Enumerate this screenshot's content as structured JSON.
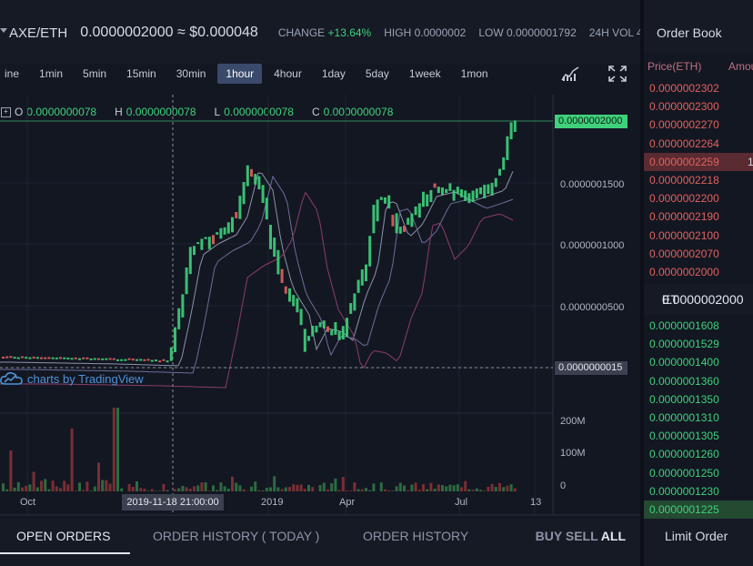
{
  "header": {
    "pair": "AXE/ETH",
    "price": "0.0000002000",
    "approx": "≈ $0.000048",
    "change_label": "CHANGE",
    "change_value": "+13.64%",
    "high_label": "HIGH",
    "high_value": "0.0000002",
    "low_label": "LOW",
    "low_value": "0.0000001792",
    "vol_label": "24H VOL",
    "vol_value": "4"
  },
  "timeframes": [
    "ine",
    "1min",
    "5min",
    "15min",
    "30min",
    "1hour",
    "4hour",
    "1day",
    "5day",
    "1week",
    "1mon"
  ],
  "active_timeframe": "1hour",
  "ohlc": {
    "check": "+",
    "o_label": "O",
    "o": "0.0000000078",
    "h_label": "H",
    "h": "0.0000000078",
    "l_label": "L",
    "l": "0.0000000078",
    "c_label": "C",
    "c": "0.0000000078"
  },
  "watermark": "charts by TradingView",
  "price_axis": [
    "0.0000001500",
    "0.0000001000",
    "0.0000000500"
  ],
  "price_tag_current": "0.0000002000",
  "price_tag_cursor": "0.0000000015",
  "volume_axis": [
    "200M",
    "100M",
    "0"
  ],
  "time_axis": [
    "Oct",
    "2019",
    "Apr",
    "Jul",
    "13"
  ],
  "time_cursor": "2019-11-18 21:00:00",
  "bottom_tabs": [
    "OPEN ORDERS",
    "ORDER HISTORY ( TODAY )",
    "ORDER HISTORY"
  ],
  "bottom_filters": {
    "buy": "BUY",
    "sell": "SELL",
    "all": "ALL"
  },
  "orderbook": {
    "title": "Order Book",
    "col_price": "Price(ETH)",
    "col_amount": "Amou",
    "asks": [
      {
        "price": "0.0000002302"
      },
      {
        "price": "0.0000002300"
      },
      {
        "price": "0.0000002270"
      },
      {
        "price": "0.0000002264"
      },
      {
        "price": "0.0000002259",
        "amount": "1"
      },
      {
        "price": "0.0000002218"
      },
      {
        "price": "0.0000002200"
      },
      {
        "price": "0.0000002190"
      },
      {
        "price": "0.0000002100"
      },
      {
        "price": "0.0000002070"
      },
      {
        "price": "0.0000002000"
      }
    ],
    "last": "0.0000002000",
    "last_unit": "ET",
    "bids": [
      {
        "price": "0.0000001608"
      },
      {
        "price": "0.0000001529"
      },
      {
        "price": "0.0000001400"
      },
      {
        "price": "0.0000001360"
      },
      {
        "price": "0.0000001350"
      },
      {
        "price": "0.0000001310"
      },
      {
        "price": "0.0000001305"
      },
      {
        "price": "0.0000001260"
      },
      {
        "price": "0.0000001250"
      },
      {
        "price": "0.0000001230"
      },
      {
        "price": "0.0000001225"
      }
    ],
    "limit_order": "Limit Order"
  },
  "colors": {
    "up": "#3fd17b",
    "down": "#e0625f",
    "accent": "#3a4a6b"
  }
}
